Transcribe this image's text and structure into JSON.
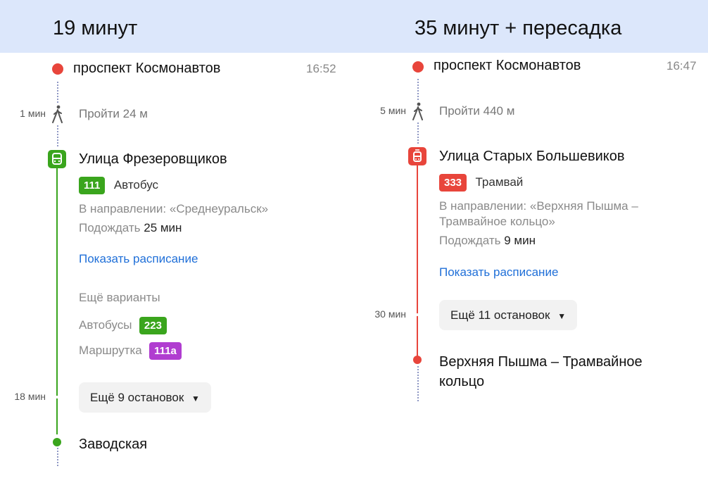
{
  "left": {
    "duration_title": "19 минут",
    "origin": {
      "name": "проспект Космонавтов",
      "time": "16:52"
    },
    "walk": {
      "duration": "1 мин",
      "text": "Пройти 24 м"
    },
    "boarding": {
      "stop": "Улица Фрезеровщиков",
      "route": {
        "number": "111",
        "type": "Автобус",
        "color": "#3aa51d"
      },
      "direction": "В направлении: «Среднеуральск»",
      "wait_prefix": "Подождать",
      "wait": "25 мин",
      "schedule_link": "Показать расписание"
    },
    "alternatives": {
      "title": "Ещё варианты",
      "buses_label": "Автобусы",
      "buses_route": "223",
      "buses_color": "#3aa51d",
      "minibus_label": "Маршрутка",
      "minibus_route": "111а",
      "minibus_color": "#b03dd0"
    },
    "ride": {
      "duration": "18 мин",
      "stops_button": "Ещё 9 остановок"
    },
    "destination": "Заводская"
  },
  "right": {
    "duration_title": "35 минут + пересадка",
    "origin": {
      "name": "проспект Космонавтов",
      "time": "16:47"
    },
    "walk": {
      "duration": "5 мин",
      "text": "Пройти 440 м"
    },
    "boarding": {
      "stop": "Улица Старых Большевиков",
      "route": {
        "number": "333",
        "type": "Трамвай",
        "color": "#e8453b"
      },
      "direction_line1": "В направлении: «Верхняя Пышма –",
      "direction_line2": "Трамвайное кольцо»",
      "wait_prefix": "Подождать",
      "wait": "9 мин",
      "schedule_link": "Показать расписание"
    },
    "ride": {
      "duration": "30 мин",
      "stops_button": "Ещё 11 остановок"
    },
    "destination_line1": "Верхняя Пышма – Трамвайное",
    "destination_line2": "кольцо"
  },
  "icons": {
    "walk": "walking-person-icon",
    "bus": "bus-icon",
    "tram": "tram-icon",
    "dropdown": "triangle-down-icon",
    "origin_dot": "red-dot"
  },
  "colors": {
    "header_bg": "#dce7fb",
    "origin_red": "#e8453b",
    "bus_green": "#3aa51d",
    "tram_red": "#e8453b",
    "minibus_purple": "#b03dd0",
    "link_blue": "#1f6fd8"
  }
}
